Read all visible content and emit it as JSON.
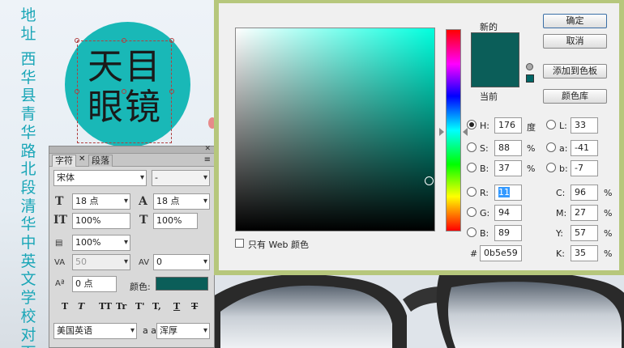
{
  "background": {
    "vertical_text_top": "地址",
    "vertical_text_address": "西华县青华路北段清华中英文学校对面",
    "logo": {
      "line1": "天目",
      "line2": "眼镜"
    },
    "colors": {
      "circle": "#19b8b7",
      "text_teal": "#1aa6b7"
    }
  },
  "character_panel": {
    "tabs": [
      "字符",
      "段落"
    ],
    "close_glyph": "✕",
    "menu_glyph": "≡",
    "tab_close_glyph": "✕",
    "font_family": "宋体",
    "font_style": "-",
    "font_size": "18 点",
    "leading": "18 点",
    "vertical_scale": "100%",
    "horizontal_scale": "100%",
    "kerning_scale": "100%",
    "tracking_kerning": "50",
    "tracking": "0",
    "baseline_shift": "0 点",
    "color_label": "颜色:",
    "color_value": "#0b5e59",
    "format_buttons": [
      "T",
      "T",
      "TT",
      "Tr",
      "T'",
      "T,",
      "T",
      "T"
    ],
    "language": "美国英语",
    "aa_label": "a a",
    "antialias": "浑厚"
  },
  "color_picker": {
    "new_label": "新的",
    "current_label": "当前",
    "new_color": "#0b5e59",
    "current_color": "#0b5e59",
    "buttons": {
      "ok": "确定",
      "cancel": "取消",
      "add_to_swatches": "添加到色板",
      "color_libraries": "颜色库"
    },
    "hsb": {
      "H": "176",
      "S": "88",
      "B": "37",
      "H_unit": "度",
      "S_unit": "%",
      "B_unit": "%"
    },
    "lab": {
      "L": "33",
      "a": "-41",
      "b": "-7"
    },
    "rgb": {
      "R": "11",
      "G": "94",
      "B": "89"
    },
    "cmyk": {
      "C": "96",
      "M": "27",
      "Y": "57",
      "K": "35",
      "unit": "%"
    },
    "hex_label": "#",
    "hex": "0b5e59",
    "web_only_label": "只有 Web 颜色",
    "labels": {
      "H": "H:",
      "S": "S:",
      "Bh": "B:",
      "L": "L:",
      "a": "a:",
      "bl": "b:",
      "R": "R:",
      "G": "G:",
      "Br": "B:",
      "C": "C:",
      "M": "M:",
      "Y": "Y:",
      "K": "K:"
    }
  }
}
